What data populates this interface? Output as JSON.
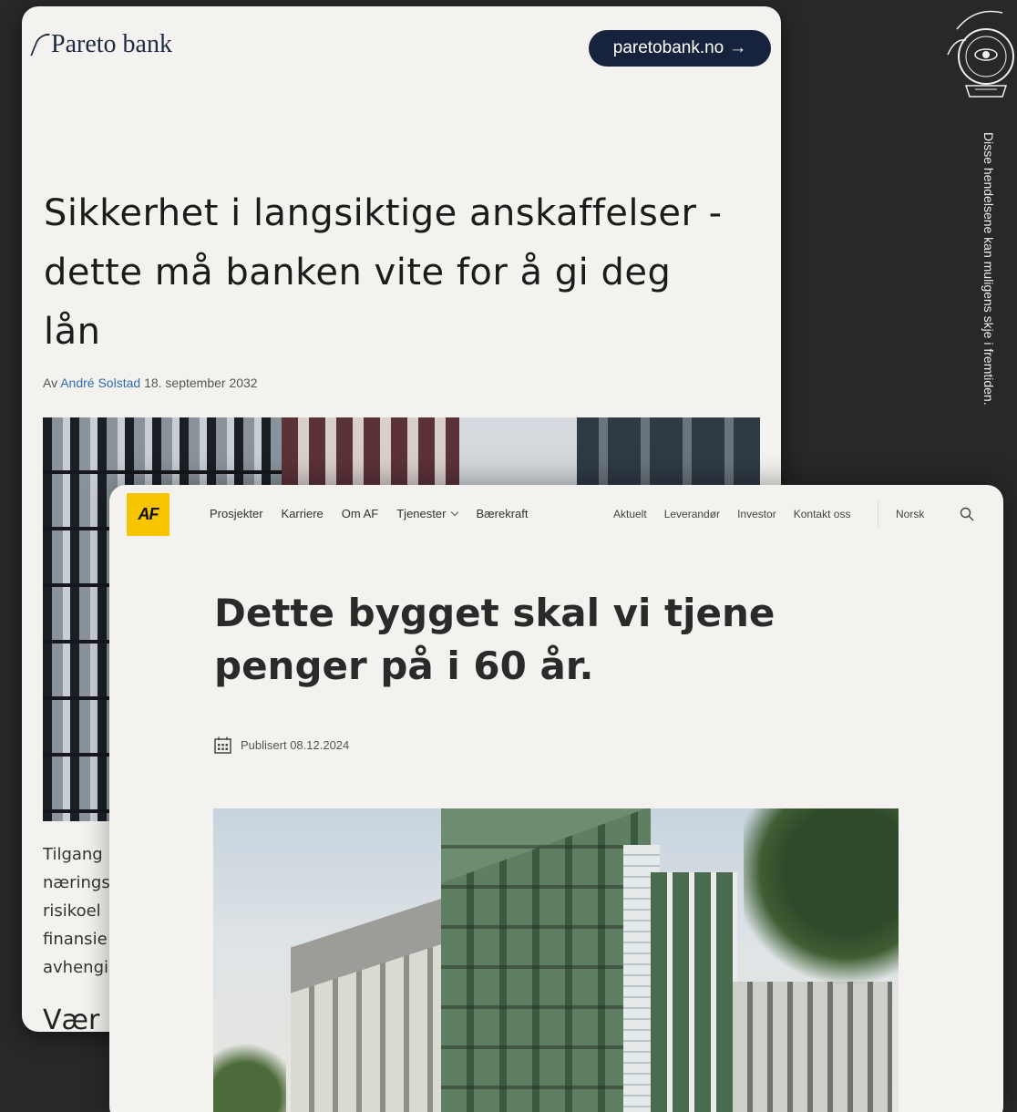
{
  "pareto": {
    "logo": "Pareto bank",
    "cta_label": "paretobank.no",
    "cta_arrow": "→",
    "title": "Sikkerhet i langsiktige anskaffelser - dette må banken vite for å gi deg lån",
    "byline_prefix": "Av",
    "author": "André Solstad",
    "date": "18. september 2032",
    "body_lines": [
      "Tilgang",
      "nærings",
      "risikoel",
      "finansie",
      "avhengi"
    ],
    "subheading_partial": "Vær"
  },
  "af": {
    "logo": "AF",
    "nav_main": [
      "Prosjekter",
      "Karriere",
      "Om AF",
      "Tjenester",
      "Bærekraft"
    ],
    "nav_secondary": [
      "Aktuelt",
      "Leverandør",
      "Investor",
      "Kontakt oss"
    ],
    "language": "Norsk",
    "title": "Dette bygget skal vi tjene penger på i 60 år.",
    "published": "Publisert 08.12.2024"
  },
  "side_text": "Disse hendelsene kan muligens skje i fremtiden.",
  "icons": {
    "af_search": "search-icon",
    "af_calendar": "calendar-icon",
    "emblem": "crystal-ball-emblem-icon",
    "cta_arrow": "arrow-right-icon",
    "dropdown": "chevron-down-icon"
  },
  "colors": {
    "background": "#282828",
    "card": "#f4f2ee",
    "pareto_navy": "#17223c",
    "author_link": "#2f6db5",
    "af_yellow": "#f7c600"
  }
}
